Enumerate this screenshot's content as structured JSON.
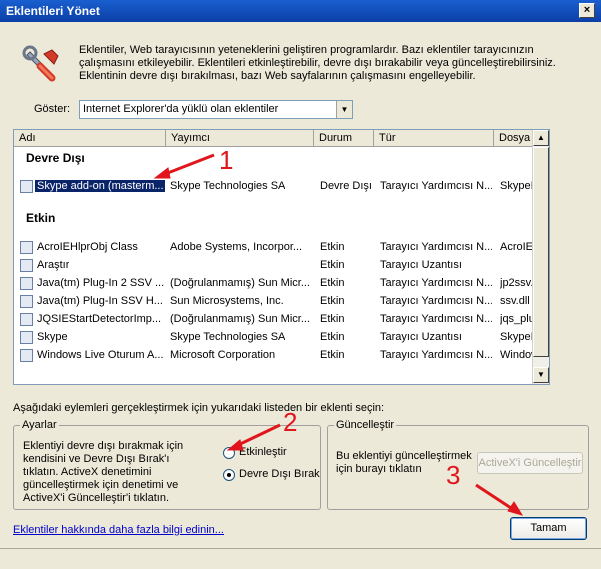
{
  "window": {
    "title": "Eklentileri Yönet",
    "close_glyph": "×"
  },
  "intro_text": "Eklentiler, Web tarayıcısının yeteneklerini geliştiren programlardır. Bazı eklentiler tarayıcınızın çalışmasını etkileyebilir. Eklentileri etkinleştirebilir, devre dışı bırakabilir veya güncelleştirebilirsiniz. Eklentinin devre dışı bırakılması, bazı Web sayfalarının çalışmasını engelleyebilir.",
  "show": {
    "label": "Göster:",
    "selected": "Internet Explorer'da yüklü olan eklentiler"
  },
  "columns": [
    "Adı",
    "Yayımcı",
    "Durum",
    "Tür",
    "Dosya"
  ],
  "groups": {
    "disabled": "Devre Dışı",
    "enabled": "Etkin"
  },
  "rows_disabled": [
    {
      "name": "Skype add-on (masterm...",
      "publisher": "Skype Technologies SA",
      "status": "Devre Dışı",
      "type": "Tarayıcı Yardımcısı N...",
      "file": "SkypeIE"
    }
  ],
  "rows_enabled": [
    {
      "name": "AcroIEHlprObj Class",
      "publisher": "Adobe Systems, Incorpor...",
      "status": "Etkin",
      "type": "Tarayıcı Yardımcısı N...",
      "file": "AcroIEh"
    },
    {
      "name": "Araştır",
      "publisher": "",
      "status": "Etkin",
      "type": "Tarayıcı Uzantısı",
      "file": ""
    },
    {
      "name": "Java(tm) Plug-In 2 SSV ...",
      "publisher": "(Doğrulanmamış) Sun Micr...",
      "status": "Etkin",
      "type": "Tarayıcı Yardımcısı N...",
      "file": "jp2ssv."
    },
    {
      "name": "Java(tm) Plug-In SSV H...",
      "publisher": "Sun Microsystems, Inc.",
      "status": "Etkin",
      "type": "Tarayıcı Yardımcısı N...",
      "file": "ssv.dll"
    },
    {
      "name": "JQSIEStartDetectorImp...",
      "publisher": "(Doğrulanmamış) Sun Micr...",
      "status": "Etkin",
      "type": "Tarayıcı Yardımcısı N...",
      "file": "jqs_plu"
    },
    {
      "name": "Skype",
      "publisher": "Skype Technologies SA",
      "status": "Etkin",
      "type": "Tarayıcı Uzantısı",
      "file": "SkypeIE"
    },
    {
      "name": "Windows Live Oturum A...",
      "publisher": "Microsoft Corporation",
      "status": "Etkin",
      "type": "Tarayıcı Yardımcısı N...",
      "file": "Window"
    }
  ],
  "action_prompt": "Aşağıdaki eylemleri gerçekleştirmek için yukarıdaki listeden bir eklenti seçin:",
  "settings": {
    "legend": "Ayarlar",
    "text": "Eklentiyi devre dışı bırakmak için kendisini ve Devre Dışı Bırak'ı tıklatın. ActiveX denetimini güncelleştirmek için denetimi ve ActiveX'i Güncelleştir'i tıklatın.",
    "enable_label": "Etkinleştir",
    "disable_label": "Devre Dışı Bırak"
  },
  "update": {
    "legend": "Güncelleştir",
    "text": "Bu eklentiyi güncelleştirmek için burayı tıklatın",
    "button": "ActiveX'i Güncelleştir"
  },
  "more_info_link": "Eklentiler hakkında daha fazla bilgi edinin...",
  "ok_button": "Tamam",
  "annotations": [
    "1",
    "2",
    "3"
  ],
  "colors": {
    "annotation": "#e0161c",
    "title_bar": "#0a3fa5",
    "selection": "#0a246a"
  }
}
